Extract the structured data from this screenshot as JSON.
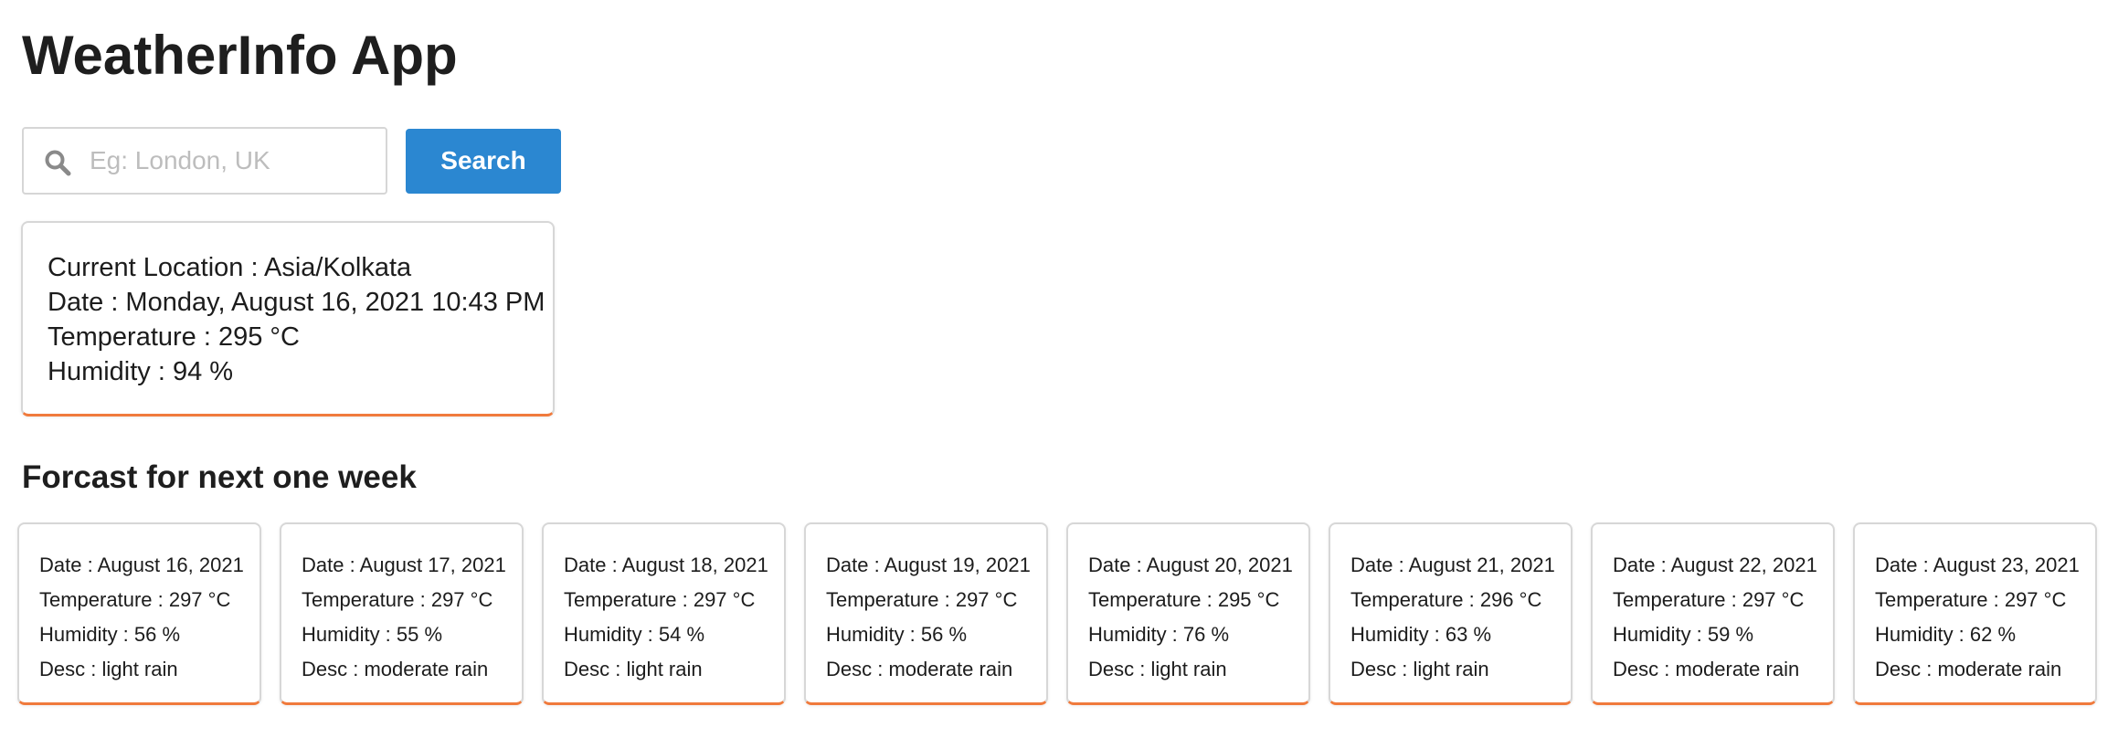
{
  "header": {
    "title": "WeatherInfo App"
  },
  "search": {
    "placeholder": "Eg: London, UK",
    "value": "",
    "button_label": "Search",
    "icon": "search-icon"
  },
  "current": {
    "location": "Current Location : Asia/Kolkata",
    "date": "Date : Monday, August 16, 2021 10:43 PM",
    "temperature": "Temperature : 295 °C",
    "humidity": "Humidity : 94 %"
  },
  "forecast": {
    "title": "Forcast for next one week",
    "days": [
      {
        "date": "Date : August 16, 2021",
        "temperature": "Temperature : 297 °C",
        "humidity": "Humidity : 56 %",
        "desc": "Desc : light rain"
      },
      {
        "date": "Date : August 17, 2021",
        "temperature": "Temperature : 297 °C",
        "humidity": "Humidity : 55 %",
        "desc": "Desc : moderate rain"
      },
      {
        "date": "Date : August 18, 2021",
        "temperature": "Temperature : 297 °C",
        "humidity": "Humidity : 54 %",
        "desc": "Desc : light rain"
      },
      {
        "date": "Date : August 19, 2021",
        "temperature": "Temperature : 297 °C",
        "humidity": "Humidity : 56 %",
        "desc": "Desc : moderate rain"
      },
      {
        "date": "Date : August 20, 2021",
        "temperature": "Temperature : 295 °C",
        "humidity": "Humidity : 76 %",
        "desc": "Desc : light rain"
      },
      {
        "date": "Date : August 21, 2021",
        "temperature": "Temperature : 296 °C",
        "humidity": "Humidity : 63 %",
        "desc": "Desc : light rain"
      },
      {
        "date": "Date : August 22, 2021",
        "temperature": "Temperature : 297 °C",
        "humidity": "Humidity : 59 %",
        "desc": "Desc : moderate rain"
      },
      {
        "date": "Date : August 23, 2021",
        "temperature": "Temperature : 297 °C",
        "humidity": "Humidity : 62 %",
        "desc": "Desc : moderate rain"
      }
    ]
  },
  "colors": {
    "accent": "#2b87d1",
    "card_bottom_border": "#f07a3c"
  }
}
